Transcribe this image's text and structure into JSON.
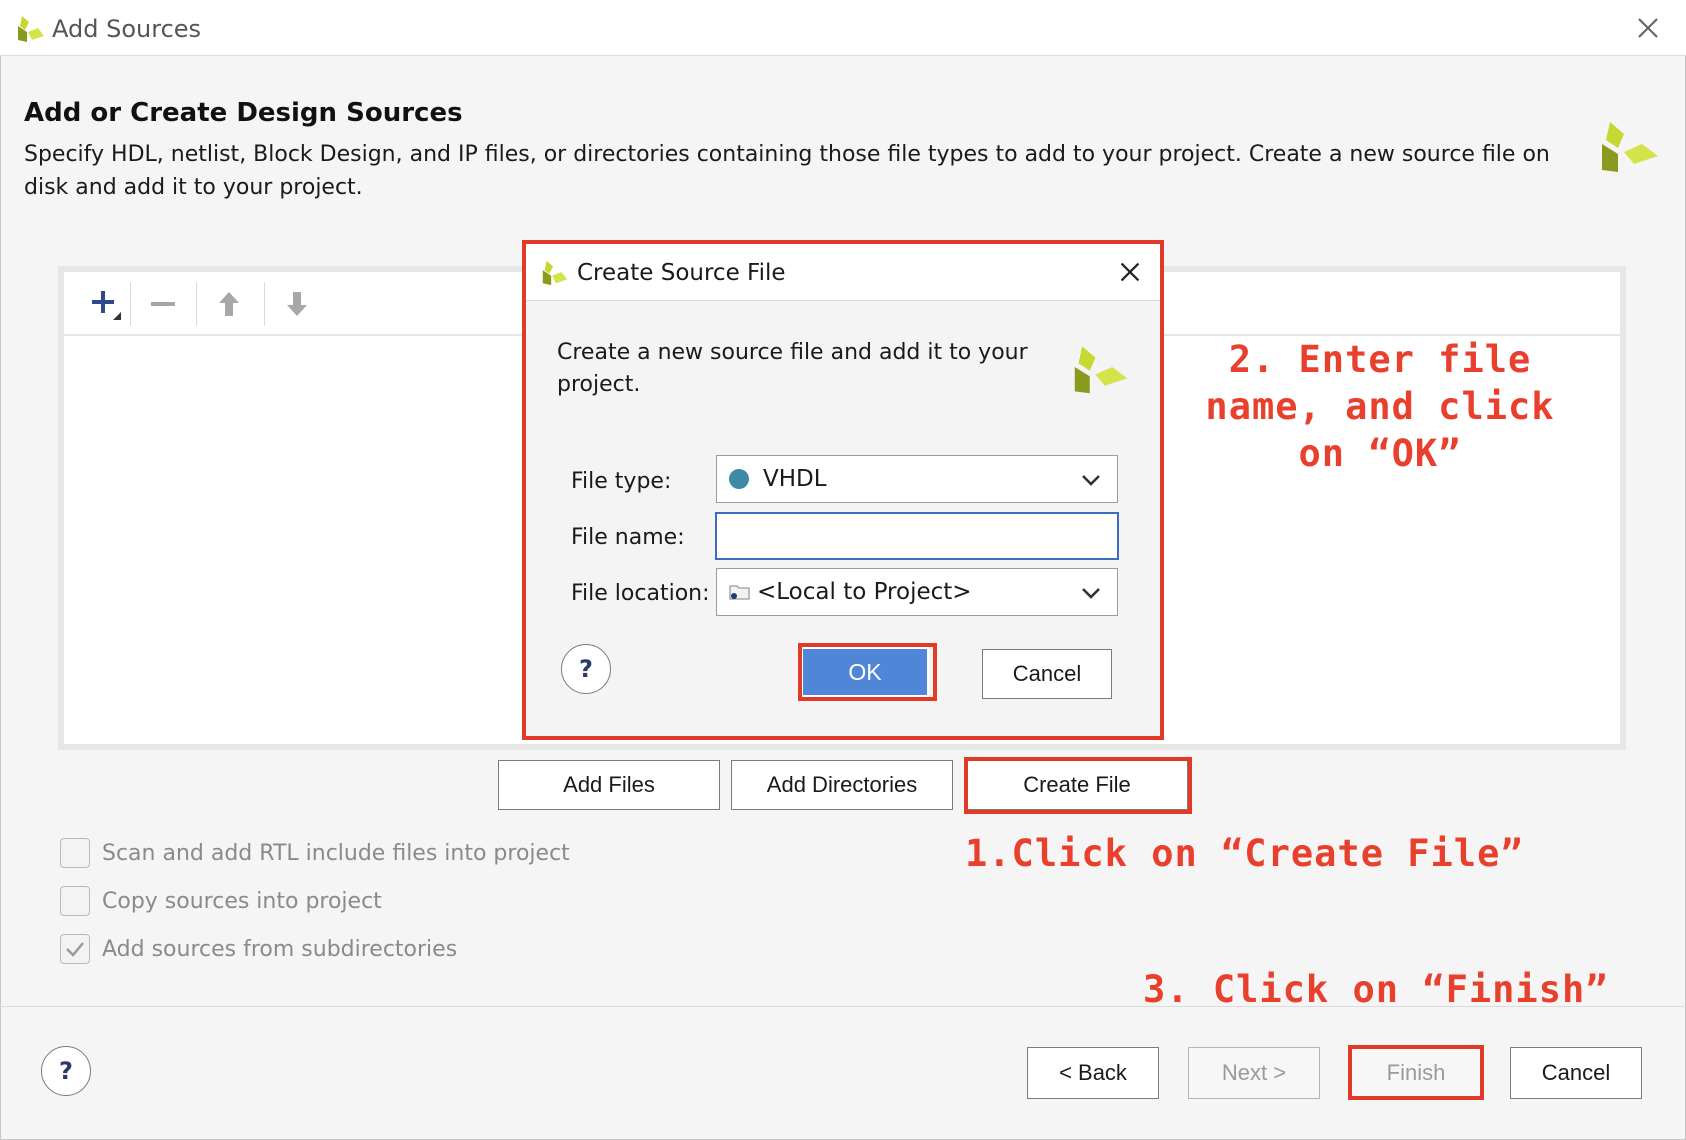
{
  "window": {
    "title": "Add Sources",
    "heading": "Add or Create Design Sources",
    "description": "Specify HDL, netlist, Block Design, and IP files, or directories containing those file types to add to your project. Create a new source file on disk and add it to your project."
  },
  "main_buttons": {
    "add_files": "Add Files",
    "add_directories": "Add Directories",
    "create_file": "Create File"
  },
  "options": [
    {
      "label": "Scan and add RTL include files into project",
      "checked": false
    },
    {
      "label": "Copy sources into project",
      "checked": false
    },
    {
      "label": "Add sources from subdirectories",
      "checked": true
    }
  ],
  "footer": {
    "help": "?",
    "back": "< Back",
    "next": "Next >",
    "finish": "Finish",
    "cancel": "Cancel"
  },
  "dialog": {
    "title": "Create Source File",
    "description": "Create a new source file and add it to your project.",
    "file_type_label": "File type:",
    "file_type_value": "VHDL",
    "file_name_label": "File name:",
    "file_name_value": "",
    "file_location_label": "File location:",
    "file_location_value": "<Local to Project>",
    "help": "?",
    "ok": "OK",
    "cancel": "Cancel"
  },
  "annotations": {
    "step1": "1.Click on “Create File”",
    "step2_line1": "2. Enter file",
    "step2_line2": "name, and click",
    "step2_line3": "on “OK”",
    "step3": "3. Click on “Finish”"
  },
  "colors": {
    "annotation_red": "#e8402d",
    "ok_blue": "#4f86d8",
    "vhdl_dot": "#3d8aa6",
    "logo_green_dark": "#8a9a1e",
    "logo_green_light": "#d4e34a"
  },
  "icons": {
    "app": "xilinx-logo-icon",
    "close": "close-icon",
    "add": "plus-icon",
    "remove": "minus-icon",
    "move_up": "arrow-up-icon",
    "move_down": "arrow-down-icon",
    "dropdown": "chevron-down-icon",
    "folder": "folder-icon"
  }
}
